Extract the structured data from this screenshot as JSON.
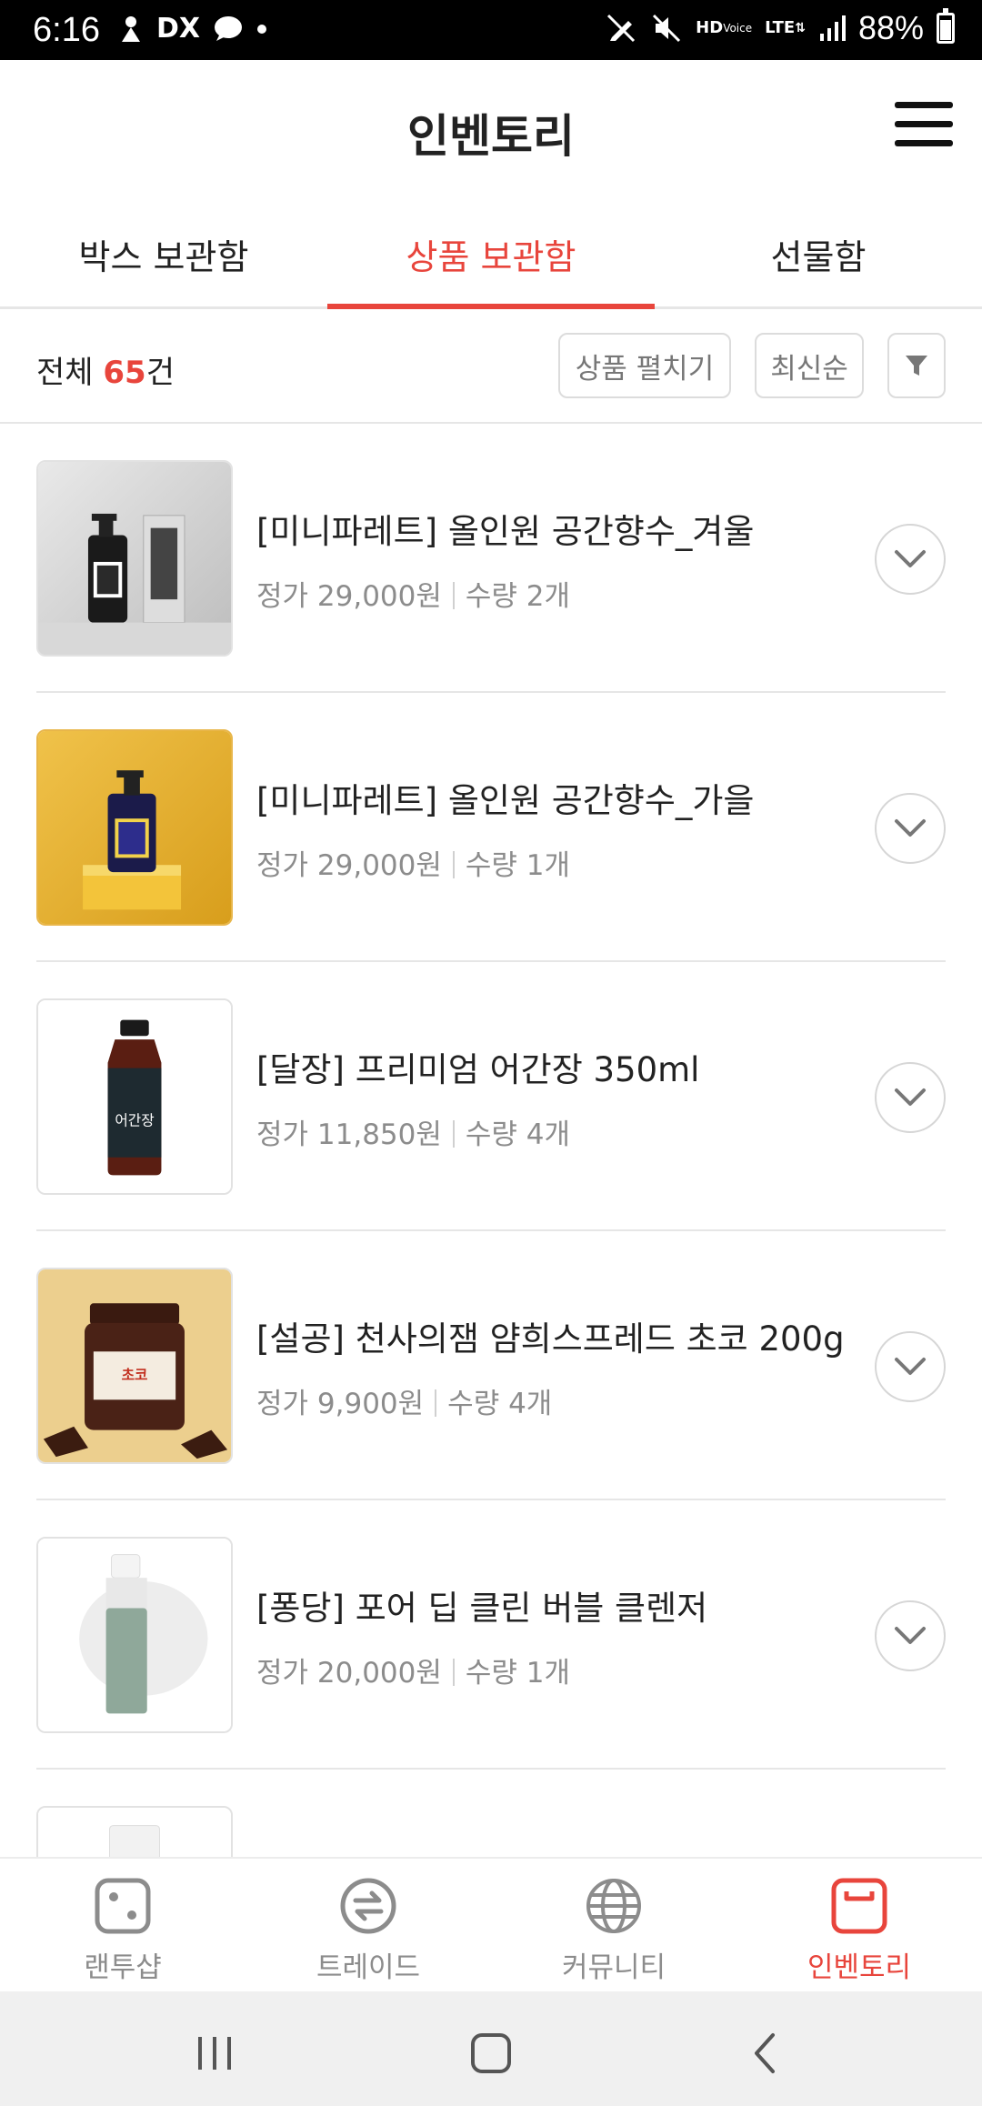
{
  "status_bar": {
    "time": "6:16",
    "battery": "88%",
    "icons": [
      "dolby-icon",
      "dx-icon",
      "chat-bubble-icon",
      "dot-icon",
      "no-write-icon",
      "mute-icon",
      "hd-voice-icon",
      "lte-icon",
      "signal-icon",
      "battery-icon"
    ]
  },
  "header": {
    "title": "인벤토리"
  },
  "tabs": [
    {
      "label": "박스 보관함",
      "active": false
    },
    {
      "label": "상품 보관함",
      "active": true
    },
    {
      "label": "선물함",
      "active": false
    }
  ],
  "toolbar": {
    "count_prefix": "전체 ",
    "count_value": "65",
    "count_suffix": "건",
    "expand_label": "상품 펼치기",
    "sort_label": "최신순"
  },
  "products": [
    {
      "name": "[미니파레트] 올인원 공간향수_겨울",
      "price": "정가 29,000원",
      "qty": "수량 2개",
      "image": "perfume-winter"
    },
    {
      "name": "[미니파레트] 올인원 공간향수_가을",
      "price": "정가 29,000원",
      "qty": "수량 1개",
      "image": "perfume-autumn"
    },
    {
      "name": "[달장] 프리미엄 어간장 350ml",
      "price": "정가 11,850원",
      "qty": "수량 4개",
      "image": "soy-sauce"
    },
    {
      "name": "[설공] 천사의잼 얌희스프레드 초코 200g",
      "price": "정가 9,900원",
      "qty": "수량 4개",
      "image": "choco-spread"
    },
    {
      "name": "[퐁당] 포어 딥 클린 버블 클렌저",
      "price": "정가 20,000원",
      "qty": "수량 1개",
      "image": "cleanser"
    }
  ],
  "bottom_nav": [
    {
      "label": "랜투샵",
      "icon": "dice-icon",
      "active": false
    },
    {
      "label": "트레이드",
      "icon": "trade-arrows-icon",
      "active": false
    },
    {
      "label": "커뮤니티",
      "icon": "globe-icon",
      "active": false
    },
    {
      "label": "인벤토리",
      "icon": "inventory-box-icon",
      "active": true
    }
  ],
  "colors": {
    "accent": "#e8453c",
    "text": "#222222",
    "muted": "#8c8c8c",
    "divider": "#e6e6e6"
  }
}
